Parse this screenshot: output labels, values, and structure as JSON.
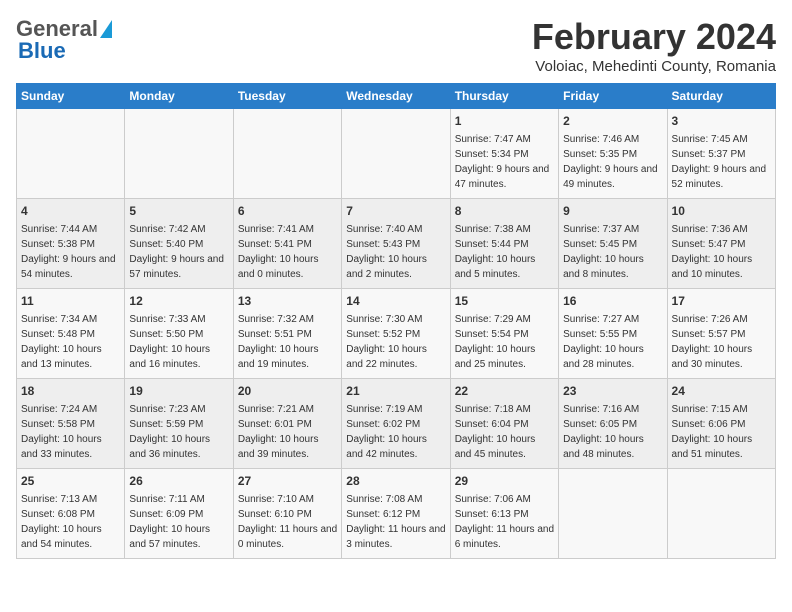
{
  "header": {
    "logo_general": "General",
    "logo_blue": "Blue",
    "month_title": "February 2024",
    "location": "Voloiac, Mehedinti County, Romania"
  },
  "calendar": {
    "days_of_week": [
      "Sunday",
      "Monday",
      "Tuesday",
      "Wednesday",
      "Thursday",
      "Friday",
      "Saturday"
    ],
    "weeks": [
      [
        {
          "day": "",
          "detail": ""
        },
        {
          "day": "",
          "detail": ""
        },
        {
          "day": "",
          "detail": ""
        },
        {
          "day": "",
          "detail": ""
        },
        {
          "day": "1",
          "detail": "Sunrise: 7:47 AM\nSunset: 5:34 PM\nDaylight: 9 hours and 47 minutes."
        },
        {
          "day": "2",
          "detail": "Sunrise: 7:46 AM\nSunset: 5:35 PM\nDaylight: 9 hours and 49 minutes."
        },
        {
          "day": "3",
          "detail": "Sunrise: 7:45 AM\nSunset: 5:37 PM\nDaylight: 9 hours and 52 minutes."
        }
      ],
      [
        {
          "day": "4",
          "detail": "Sunrise: 7:44 AM\nSunset: 5:38 PM\nDaylight: 9 hours and 54 minutes."
        },
        {
          "day": "5",
          "detail": "Sunrise: 7:42 AM\nSunset: 5:40 PM\nDaylight: 9 hours and 57 minutes."
        },
        {
          "day": "6",
          "detail": "Sunrise: 7:41 AM\nSunset: 5:41 PM\nDaylight: 10 hours and 0 minutes."
        },
        {
          "day": "7",
          "detail": "Sunrise: 7:40 AM\nSunset: 5:43 PM\nDaylight: 10 hours and 2 minutes."
        },
        {
          "day": "8",
          "detail": "Sunrise: 7:38 AM\nSunset: 5:44 PM\nDaylight: 10 hours and 5 minutes."
        },
        {
          "day": "9",
          "detail": "Sunrise: 7:37 AM\nSunset: 5:45 PM\nDaylight: 10 hours and 8 minutes."
        },
        {
          "day": "10",
          "detail": "Sunrise: 7:36 AM\nSunset: 5:47 PM\nDaylight: 10 hours and 10 minutes."
        }
      ],
      [
        {
          "day": "11",
          "detail": "Sunrise: 7:34 AM\nSunset: 5:48 PM\nDaylight: 10 hours and 13 minutes."
        },
        {
          "day": "12",
          "detail": "Sunrise: 7:33 AM\nSunset: 5:50 PM\nDaylight: 10 hours and 16 minutes."
        },
        {
          "day": "13",
          "detail": "Sunrise: 7:32 AM\nSunset: 5:51 PM\nDaylight: 10 hours and 19 minutes."
        },
        {
          "day": "14",
          "detail": "Sunrise: 7:30 AM\nSunset: 5:52 PM\nDaylight: 10 hours and 22 minutes."
        },
        {
          "day": "15",
          "detail": "Sunrise: 7:29 AM\nSunset: 5:54 PM\nDaylight: 10 hours and 25 minutes."
        },
        {
          "day": "16",
          "detail": "Sunrise: 7:27 AM\nSunset: 5:55 PM\nDaylight: 10 hours and 28 minutes."
        },
        {
          "day": "17",
          "detail": "Sunrise: 7:26 AM\nSunset: 5:57 PM\nDaylight: 10 hours and 30 minutes."
        }
      ],
      [
        {
          "day": "18",
          "detail": "Sunrise: 7:24 AM\nSunset: 5:58 PM\nDaylight: 10 hours and 33 minutes."
        },
        {
          "day": "19",
          "detail": "Sunrise: 7:23 AM\nSunset: 5:59 PM\nDaylight: 10 hours and 36 minutes."
        },
        {
          "day": "20",
          "detail": "Sunrise: 7:21 AM\nSunset: 6:01 PM\nDaylight: 10 hours and 39 minutes."
        },
        {
          "day": "21",
          "detail": "Sunrise: 7:19 AM\nSunset: 6:02 PM\nDaylight: 10 hours and 42 minutes."
        },
        {
          "day": "22",
          "detail": "Sunrise: 7:18 AM\nSunset: 6:04 PM\nDaylight: 10 hours and 45 minutes."
        },
        {
          "day": "23",
          "detail": "Sunrise: 7:16 AM\nSunset: 6:05 PM\nDaylight: 10 hours and 48 minutes."
        },
        {
          "day": "24",
          "detail": "Sunrise: 7:15 AM\nSunset: 6:06 PM\nDaylight: 10 hours and 51 minutes."
        }
      ],
      [
        {
          "day": "25",
          "detail": "Sunrise: 7:13 AM\nSunset: 6:08 PM\nDaylight: 10 hours and 54 minutes."
        },
        {
          "day": "26",
          "detail": "Sunrise: 7:11 AM\nSunset: 6:09 PM\nDaylight: 10 hours and 57 minutes."
        },
        {
          "day": "27",
          "detail": "Sunrise: 7:10 AM\nSunset: 6:10 PM\nDaylight: 11 hours and 0 minutes."
        },
        {
          "day": "28",
          "detail": "Sunrise: 7:08 AM\nSunset: 6:12 PM\nDaylight: 11 hours and 3 minutes."
        },
        {
          "day": "29",
          "detail": "Sunrise: 7:06 AM\nSunset: 6:13 PM\nDaylight: 11 hours and 6 minutes."
        },
        {
          "day": "",
          "detail": ""
        },
        {
          "day": "",
          "detail": ""
        }
      ]
    ]
  }
}
